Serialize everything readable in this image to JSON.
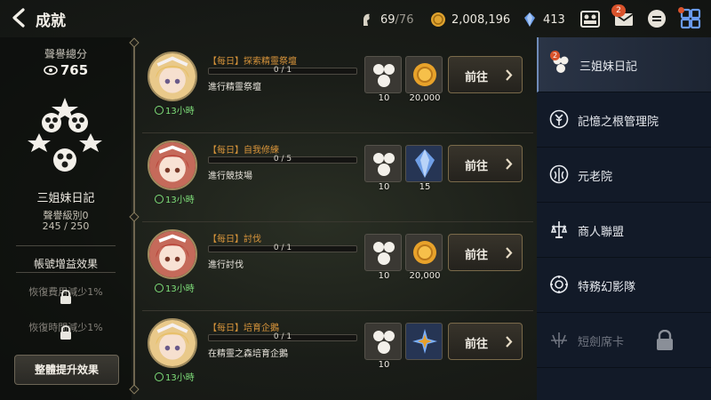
{
  "header": {
    "title": "成就",
    "stamina": "69",
    "stamina_max": "/76",
    "gold": "2,008,196",
    "crystal": "413",
    "mail_badge": "2"
  },
  "left_panel": {
    "score_label": "聲譽總分",
    "score": "765",
    "faction_name": "三姐妹日記",
    "level": "聲譽級別0",
    "exp": "245 / 250",
    "bonus_title": "帳號增益效果",
    "locked_bonus_1": "恢復費用減少1%",
    "locked_bonus_2": "恢復時間減少1%",
    "upgrade_button": "整體提升效果"
  },
  "quests": [
    {
      "title": "【每日】探索精靈祭壇",
      "progress": "0 / 1",
      "progress_value": 0,
      "description": "進行精靈祭壇",
      "timer": "13小時",
      "reward1_value": "10",
      "reward2_value": "20,000",
      "reward2_icon": "gold-coin-icon",
      "go_label": "前往"
    },
    {
      "title": "【每日】自我修練",
      "progress": "0 / 5",
      "progress_value": 0,
      "description": "進行競技場",
      "timer": "13小時",
      "reward1_value": "10",
      "reward2_value": "15",
      "reward2_icon": "crystal-icon",
      "go_label": "前往"
    },
    {
      "title": "【每日】討伐",
      "progress": "0 / 1",
      "progress_value": 0,
      "description": "進行討伐",
      "timer": "13小時",
      "reward1_value": "10",
      "reward2_value": "20,000",
      "reward2_icon": "gold-coin-icon",
      "go_label": "前往"
    },
    {
      "title": "【每日】培育企鵝",
      "progress": "0 / 1",
      "progress_value": 0,
      "description": "在精靈之森培育企鵝",
      "timer": "13小時",
      "reward1_value": "10",
      "reward2_value": "",
      "reward2_icon": "rune-star-icon",
      "go_label": "前往"
    }
  ],
  "sidebar": {
    "items": [
      {
        "label": "三姐妹日記",
        "badge": "2",
        "active": true,
        "locked": false
      },
      {
        "label": "記憶之根管理院",
        "active": false,
        "locked": false
      },
      {
        "label": "元老院",
        "active": false,
        "locked": false
      },
      {
        "label": "商人聯盟",
        "active": false,
        "locked": false
      },
      {
        "label": "特務幻影隊",
        "active": false,
        "locked": false
      },
      {
        "label": "短劍席卡",
        "active": false,
        "locked": true
      }
    ]
  },
  "colors": {
    "quest_title": "#d9953b",
    "timer_green": "#7fe07a",
    "sidebar_bg": "#121a28",
    "badge_red": "#d9532c"
  }
}
